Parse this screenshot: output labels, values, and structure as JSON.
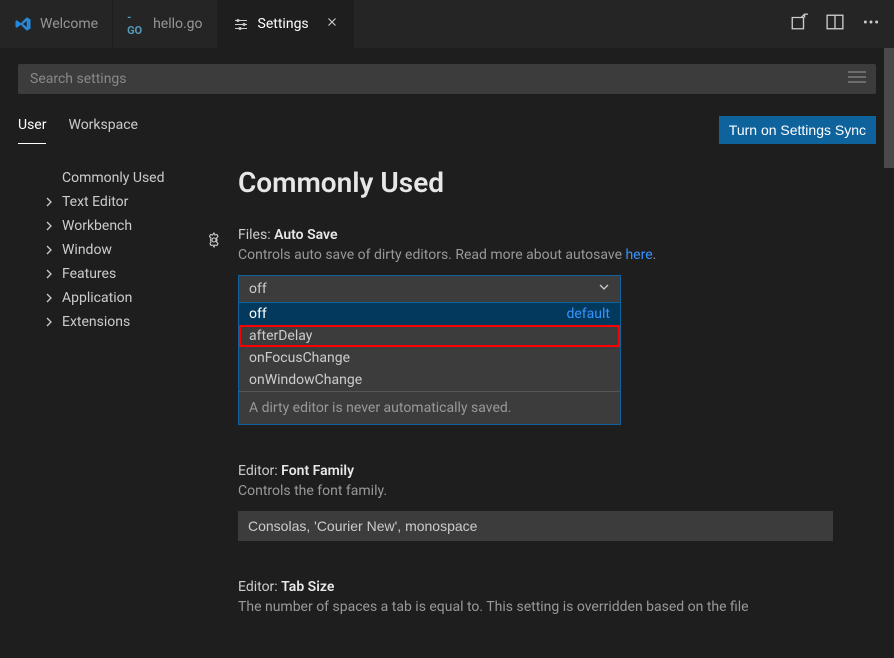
{
  "tabs": [
    {
      "label": "Welcome",
      "icon": "vscode"
    },
    {
      "label": "hello.go",
      "icon": "go"
    },
    {
      "label": "Settings",
      "icon": "settings",
      "active": true
    }
  ],
  "search": {
    "placeholder": "Search settings"
  },
  "scope": {
    "user": "User",
    "workspace": "Workspace",
    "sync_button": "Turn on Settings Sync"
  },
  "tree": {
    "commonly_used": "Commonly Used",
    "text_editor": "Text Editor",
    "workbench": "Workbench",
    "window": "Window",
    "features": "Features",
    "application": "Application",
    "extensions": "Extensions"
  },
  "section": {
    "title": "Commonly Used"
  },
  "settings": {
    "auto_save": {
      "prefix": "Files: ",
      "name": "Auto Save",
      "desc_before": "Controls auto save of dirty editors. Read more about autosave ",
      "desc_link": "here",
      "desc_after": ".",
      "selected": "off",
      "options": {
        "off": "off",
        "off_badge": "default",
        "afterDelay": "afterDelay",
        "onFocusChange": "onFocusChange",
        "onWindowChange": "onWindowChange"
      },
      "help": "A dirty editor is never automatically saved."
    },
    "font_family": {
      "prefix": "Editor: ",
      "name": "Font Family",
      "desc": "Controls the font family.",
      "value": "Consolas, 'Courier New', monospace"
    },
    "tab_size": {
      "prefix": "Editor: ",
      "name": "Tab Size",
      "desc": "The number of spaces a tab is equal to. This setting is overridden based on the file"
    }
  }
}
